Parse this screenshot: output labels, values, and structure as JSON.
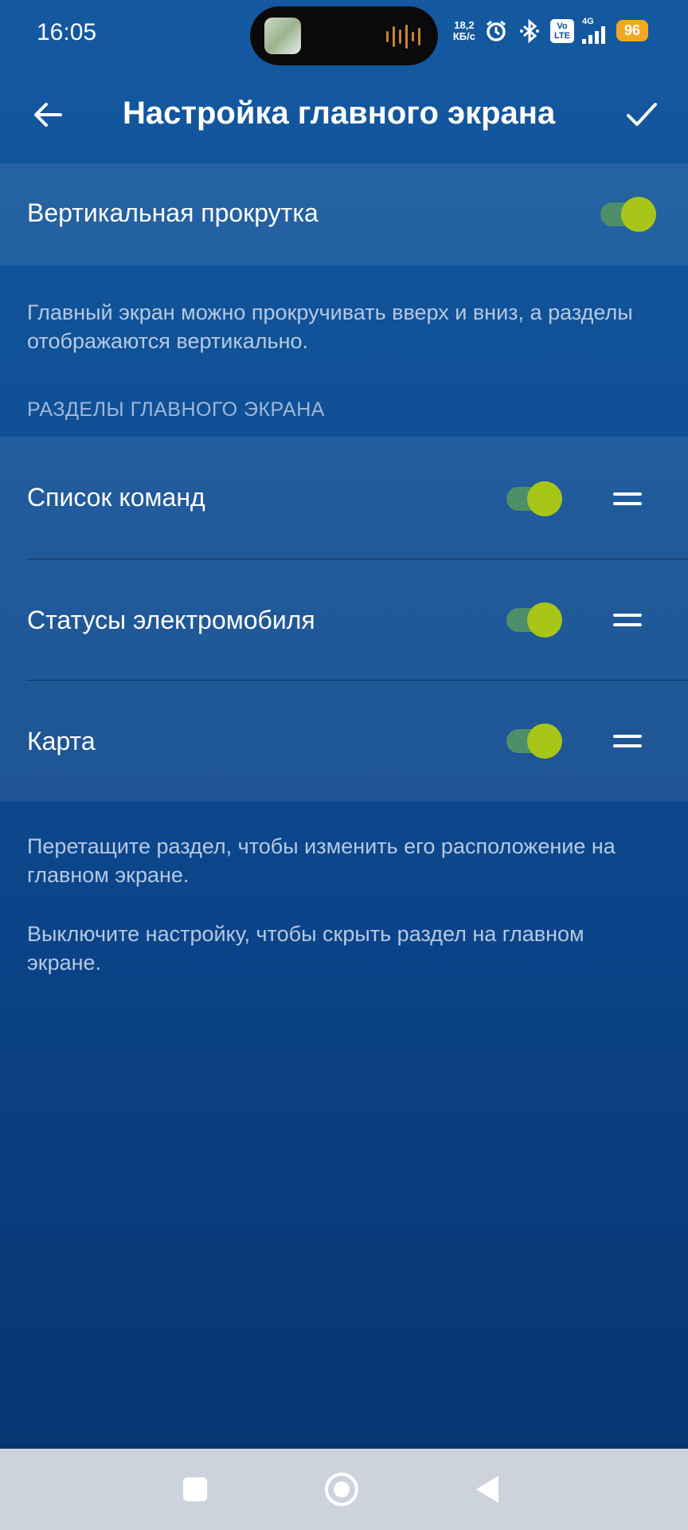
{
  "status_bar": {
    "time": "16:05",
    "speed_value": "18,2",
    "speed_unit": "КБ/с",
    "volte_top": "Vo",
    "volte_bottom": "LTE",
    "network": "4G",
    "battery": "96"
  },
  "app_bar": {
    "title": "Настройка главного экрана"
  },
  "vertical_scroll": {
    "label": "Вертикальная прокрутка",
    "enabled": true,
    "description": "Главный экран можно прокручивать вверх и вниз, а разделы отображаются вертикально."
  },
  "sections": {
    "header": "РАЗДЕЛЫ ГЛАВНОГО ЭКРАНА",
    "items": [
      {
        "label": "Список команд",
        "enabled": true
      },
      {
        "label": "Статусы электромобиля",
        "enabled": true
      },
      {
        "label": "Карта",
        "enabled": true
      }
    ]
  },
  "hints": {
    "drag": "Перетащите раздел, чтобы изменить его расположение на главном экране.",
    "hide": "Выключите настройку, чтобы скрыть раздел на главном экране."
  },
  "colors": {
    "toggle_thumb": "#a8c617",
    "toggle_track": "#4e8f6a",
    "battery": "#f5a623"
  }
}
